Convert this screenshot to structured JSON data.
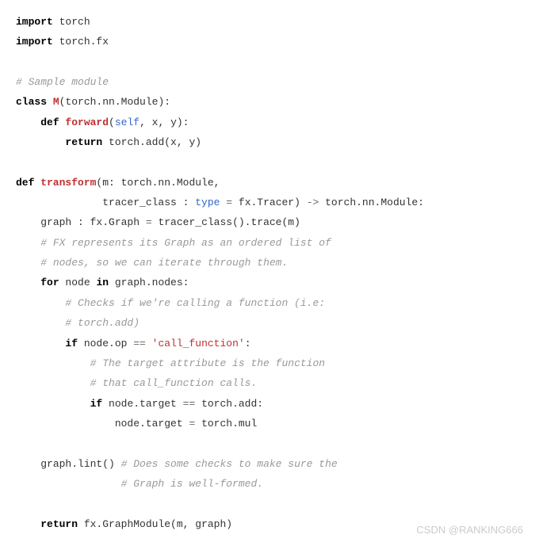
{
  "code": {
    "l01_kw1": "import",
    "l01_t": " torch",
    "l02_kw1": "import",
    "l02_t": " torch.fx",
    "l04_cm": "# Sample module",
    "l05_kw1": "class",
    "l05_fn": " M",
    "l05_t1": "(torch.nn.Module):",
    "l06_kw1": "def",
    "l06_fn": " forward",
    "l06_t1": "(",
    "l06_bi": "self",
    "l06_t2": ", x, y):",
    "l07_kw1": "return",
    "l07_t": " torch.add(x, y)",
    "l09_kw1": "def",
    "l09_fn": " transform",
    "l09_t1": "(m: torch.nn.Module,",
    "l10_t1": "tracer_class : ",
    "l10_bi": "type",
    "l10_t2": " ",
    "l10_op": "=",
    "l10_t3": " fx.Tracer) ",
    "l10_op2": "->",
    "l10_t4": " torch.nn.Module:",
    "l11_t1": "graph : fx.Graph ",
    "l11_op": "=",
    "l11_t2": " tracer_class().trace(m)",
    "l12_cm": "# FX represents its Graph as an ordered list of",
    "l13_cm": "# nodes, so we can iterate through them.",
    "l14_kw1": "for",
    "l14_t1": " node ",
    "l14_kw2": "in",
    "l14_t2": " graph.nodes:",
    "l15_cm": "# Checks if we're calling a function (i.e:",
    "l16_cm": "# torch.add)",
    "l17_kw1": "if",
    "l17_t1": " node.op ",
    "l17_op": "==",
    "l17_t2": " ",
    "l17_st": "'call_function'",
    "l17_t3": ":",
    "l18_cm": "# The target attribute is the function",
    "l19_cm": "# that call_function calls.",
    "l20_kw1": "if",
    "l20_t1": " node.target ",
    "l20_op": "==",
    "l20_t2": " torch.add:",
    "l21_t1": "node.target ",
    "l21_op": "=",
    "l21_t2": " torch.mul",
    "l23_t1": "graph.lint() ",
    "l23_cm": "# Does some checks to make sure the",
    "l24_cm": "# Graph is well-formed.",
    "l26_kw1": "return",
    "l26_t": " fx.GraphModule(m, graph)"
  },
  "watermark": "CSDN @RANKING666"
}
